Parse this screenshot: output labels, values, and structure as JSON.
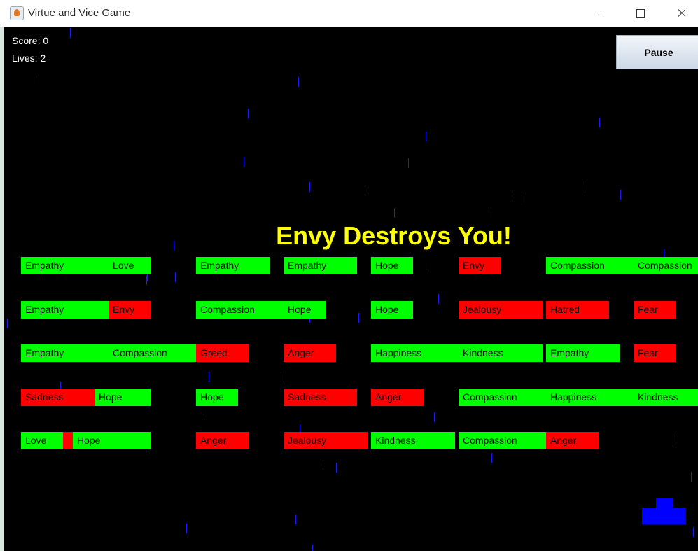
{
  "window": {
    "title": "Virtue and Vice Game",
    "controls": [
      "minimize",
      "maximize",
      "close"
    ]
  },
  "hud": {
    "score": "Score: 0",
    "lives": "Lives: 2"
  },
  "pause_button": {
    "label": "Pause"
  },
  "message": "Envy Destroys You!",
  "colors": {
    "virtue": "#00ff00",
    "vice": "#ff0000",
    "message": "#ffff00",
    "paddle": "#0000ff",
    "rain": "#1a1aff",
    "background": "#000000"
  },
  "rows": [
    [
      {
        "label": "Empathy",
        "type": "virtue"
      },
      {
        "label": "Love",
        "type": "virtue"
      },
      {
        "label": "Empathy",
        "type": "virtue"
      },
      {
        "label": "Empathy",
        "type": "virtue"
      },
      {
        "label": "Hope",
        "type": "virtue"
      },
      {
        "label": "Envy",
        "type": "vice"
      },
      {
        "label": "Compassion",
        "type": "virtue"
      },
      {
        "label": "Compassion",
        "type": "virtue"
      }
    ],
    [
      {
        "label": "Empathy",
        "type": "virtue"
      },
      {
        "label": "Envy",
        "type": "vice"
      },
      {
        "label": "Compassion",
        "type": "virtue"
      },
      {
        "label": "Hope",
        "type": "virtue"
      },
      {
        "label": "Hope",
        "type": "virtue"
      },
      {
        "label": "Jealousy",
        "type": "vice"
      },
      {
        "label": "Hatred",
        "type": "vice"
      },
      {
        "label": "Fear",
        "type": "vice"
      }
    ],
    [
      {
        "label": "Empathy",
        "type": "virtue"
      },
      {
        "label": "Compassion",
        "type": "virtue"
      },
      {
        "label": "Greed",
        "type": "vice"
      },
      {
        "label": "Anger",
        "type": "vice"
      },
      {
        "label": "Happiness",
        "type": "virtue"
      },
      {
        "label": "Kindness",
        "type": "virtue"
      },
      {
        "label": "Empathy",
        "type": "virtue"
      },
      {
        "label": "Fear",
        "type": "vice"
      }
    ],
    [
      {
        "label": "Sadness",
        "type": "vice"
      },
      {
        "label": "Hope",
        "type": "virtue"
      },
      {
        "label": "Hope",
        "type": "virtue"
      },
      {
        "label": "Sadness",
        "type": "vice"
      },
      {
        "label": "Anger",
        "type": "vice"
      },
      {
        "label": "Compassion",
        "type": "virtue"
      },
      {
        "label": "Happiness",
        "type": "virtue"
      },
      {
        "label": "Kindness",
        "type": "virtue"
      }
    ],
    [
      {
        "label": "Love",
        "type": "virtue"
      },
      {
        "label": "",
        "type": "vice"
      },
      {
        "label": "Hope",
        "type": "virtue"
      },
      {
        "label": "Anger",
        "type": "vice"
      },
      {
        "label": "Jealousy",
        "type": "vice"
      },
      {
        "label": "Kindness",
        "type": "virtue"
      },
      {
        "label": "Compassion",
        "type": "virtue"
      },
      {
        "label": "Anger",
        "type": "vice"
      }
    ]
  ]
}
